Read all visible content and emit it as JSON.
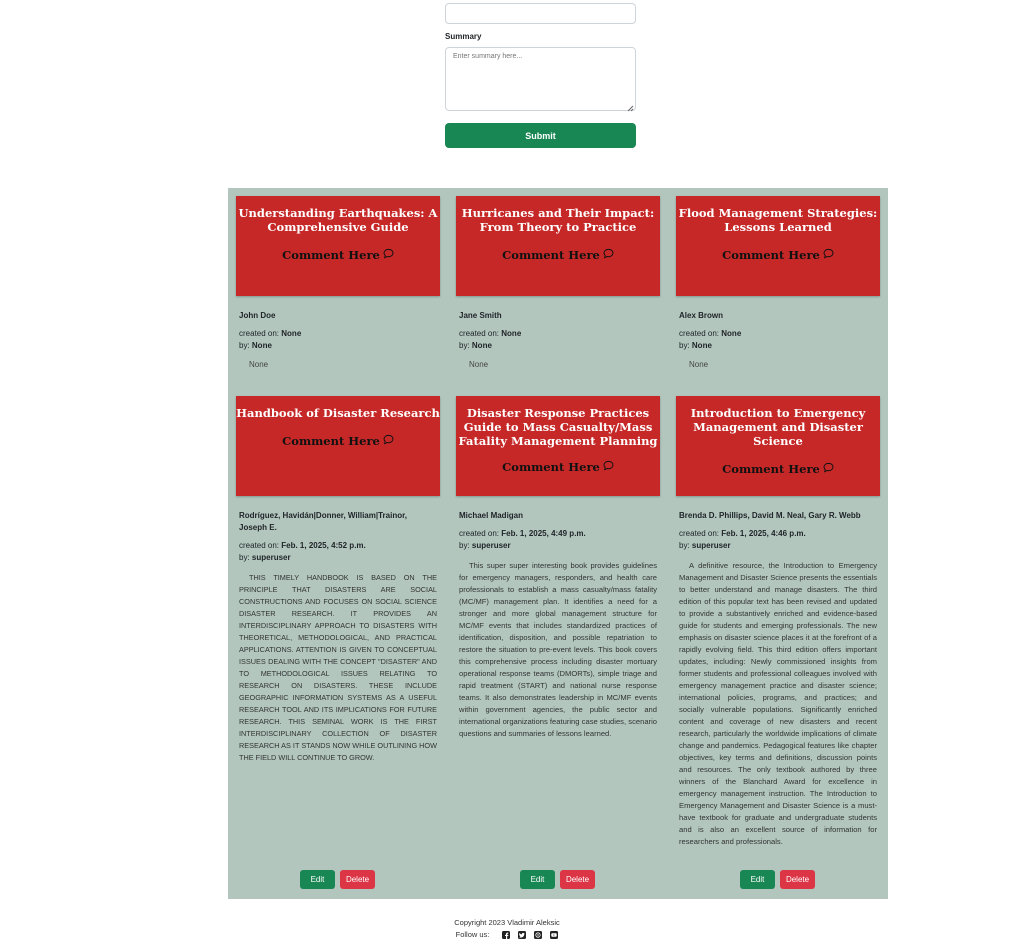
{
  "form": {
    "summary_label": "Summary",
    "summary_placeholder": "Enter summary here...",
    "submit_label": "Submit"
  },
  "cards": [
    {
      "title": "Understanding Earthquakes: A Comprehensive Guide",
      "comment_label": "Comment Here",
      "author": "John Doe",
      "created_prefix": "created on:",
      "created_value": "None",
      "by_prefix": "by:",
      "by_value": "None",
      "summary": "None"
    },
    {
      "title": "Hurricanes and Their Impact: From Theory to Practice",
      "comment_label": "Comment Here",
      "author": "Jane Smith",
      "created_prefix": "created on:",
      "created_value": "None",
      "by_prefix": "by:",
      "by_value": "None",
      "summary": "None"
    },
    {
      "title": "Flood Management Strategies: Lessons Learned",
      "comment_label": "Comment Here",
      "author": "Alex Brown",
      "created_prefix": "created on:",
      "created_value": "None",
      "by_prefix": "by:",
      "by_value": "None",
      "summary": "None"
    },
    {
      "title": "Handbook of Disaster Research",
      "comment_label": "Comment Here",
      "author": "Rodríguez, Havidán|Donner, William|Trainor, Joseph E.",
      "created_prefix": "created on:",
      "created_value": "Feb. 1, 2025, 4:52 p.m.",
      "by_prefix": "by:",
      "by_value": "superuser",
      "summary": "THIS TIMELY HANDBOOK IS BASED ON THE PRINCIPLE THAT DISASTERS ARE SOCIAL CONSTRUCTIONS AND FOCUSES ON SOCIAL SCIENCE DISASTER RESEARCH. IT PROVIDES AN INTERDISCIPLINARY APPROACH TO DISASTERS WITH THEORETICAL, METHODOLOGICAL, AND PRACTICAL APPLICATIONS. ATTENTION IS GIVEN TO CONCEPTUAL ISSUES DEALING WITH THE CONCEPT \"DISASTER\" AND TO METHODOLOGICAL ISSUES RELATING TO RESEARCH ON DISASTERS. THESE INCLUDE GEOGRAPHIC INFORMATION SYSTEMS AS A USEFUL RESEARCH TOOL AND ITS IMPLICATIONS FOR FUTURE RESEARCH. THIS SEMINAL WORK IS THE FIRST INTERDISCIPLINARY COLLECTION OF DISASTER RESEARCH AS IT STANDS NOW WHILE OUTLINING HOW THE FIELD WILL CONTINUE TO GROW.",
      "edit_label": "Edit",
      "delete_label": "Delete"
    },
    {
      "title": "Disaster Response Practices Guide to Mass Casualty/Mass Fatality Management Planning",
      "comment_label": "Comment Here",
      "author": "Michael Madigan",
      "created_prefix": "created on:",
      "created_value": "Feb. 1, 2025, 4:49 p.m.",
      "by_prefix": "by:",
      "by_value": "superuser",
      "summary": "This super super interesting book provides guidelines for emergency managers, responders, and health care professionals to establish a mass casualty/mass fatality (MC/MF) management plan. It identifies a need for a stronger and more global management structure for MC/MF events that includes standardized practices of identification, disposition, and possible repatriation to restore the situation to pre-event levels. This book covers this comprehensive process including disaster mortuary operational response teams (DMORTs), simple triage and rapid treatment (START) and national nurse response teams. It also demonstrates leadership in MC/MF events within government agencies, the public sector and international organizations featuring case studies, scenario questions and summaries of lessons learned.",
      "edit_label": "Edit",
      "delete_label": "Delete"
    },
    {
      "title": "Introduction to Emergency Management and Disaster Science",
      "comment_label": "Comment Here",
      "author": "Brenda D. Phillips, David M. Neal, Gary R. Webb",
      "created_prefix": "created on:",
      "created_value": "Feb. 1, 2025, 4:46 p.m.",
      "by_prefix": "by:",
      "by_value": "superuser",
      "summary": "A definitive resource, the Introduction to Emergency Management and Disaster Science presents the essentials to better understand and manage disasters. The third edition of this popular text has been revised and updated to provide a substantively enriched and evidence-based guide for students and emerging professionals. The new emphasis on disaster science places it at the forefront of a rapidly evolving field. This third edition offers important updates, including: Newly commissioned insights from former students and professional colleagues involved with emergency management practice and disaster science; international policies, programs, and practices; and socially vulnerable populations. Significantly enriched content and coverage of new disasters and recent research, particularly the worldwide implications of climate change and pandemics. Pedagogical features like chapter objectives, key terms and definitions, discussion points and resources. The only textbook authored by three winners of the Blanchard Award for excellence in emergency management instruction. The Introduction to Emergency Management and Disaster Science is a must-have textbook for graduate and undergraduate students and is also an excellent source of information for researchers and professionals.",
      "edit_label": "Edit",
      "delete_label": "Delete"
    }
  ],
  "footer": {
    "copyright": "Copyright 2023 Vladimir Aleksic",
    "follow_label": "Follow us:",
    "social_icons": [
      "facebook-icon",
      "twitter-icon",
      "whatsapp-icon",
      "youtube-icon"
    ]
  },
  "colors": {
    "panel_bg": "#b2c6be",
    "card_head": "#c62828",
    "success": "#198754",
    "danger": "#dc3545"
  }
}
